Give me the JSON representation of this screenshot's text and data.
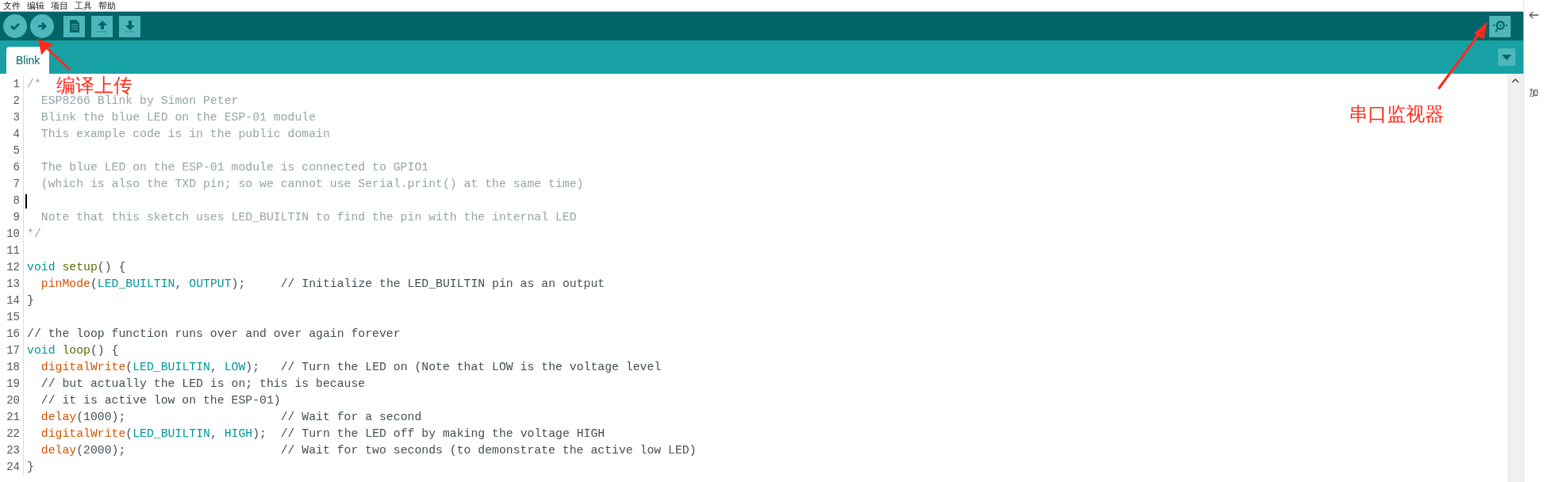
{
  "menu": [
    "文件",
    "编辑",
    "项目",
    "工具",
    "帮助"
  ],
  "toolbar": {
    "buttons": [
      {
        "kind": "verify"
      },
      {
        "kind": "upload"
      },
      {
        "kind": "new"
      },
      {
        "kind": "open"
      },
      {
        "kind": "save"
      }
    ],
    "right_button": {
      "kind": "serial-monitor"
    }
  },
  "tabs": [
    {
      "label": "Blink",
      "selected": true
    }
  ],
  "editor": {
    "lines": [
      {
        "n": "1",
        "cursor": false,
        "tokens": [
          {
            "kind": "comment",
            "t": "/*"
          }
        ]
      },
      {
        "n": "2",
        "cursor": false,
        "tokens": [
          {
            "kind": "comment",
            "t": "  ESP8266 Blink by Simon Peter"
          }
        ]
      },
      {
        "n": "3",
        "cursor": false,
        "tokens": [
          {
            "kind": "comment",
            "t": "  Blink the blue LED on the ESP-01 module"
          }
        ]
      },
      {
        "n": "4",
        "cursor": false,
        "tokens": [
          {
            "kind": "comment",
            "t": "  This example code is in the public domain"
          }
        ]
      },
      {
        "n": "5",
        "cursor": false
      },
      {
        "n": "6",
        "cursor": false,
        "tokens": [
          {
            "kind": "comment",
            "t": "  The blue LED on the ESP-01 module is connected to GPIO1"
          }
        ]
      },
      {
        "n": "7",
        "cursor": false,
        "tokens": [
          {
            "kind": "comment",
            "t": "  (which is also the TXD pin; so we cannot use Serial.print() at the same time)"
          }
        ]
      },
      {
        "n": "8",
        "cursor": true
      },
      {
        "n": "9",
        "cursor": false,
        "tokens": [
          {
            "kind": "comment",
            "t": "  Note that this sketch uses LED_BUILTIN to find the pin with the internal LED"
          }
        ]
      },
      {
        "n": "10",
        "cursor": false,
        "tokens": [
          {
            "kind": "comment",
            "t": "*/"
          }
        ]
      },
      {
        "n": "11",
        "cursor": false
      },
      {
        "n": "12",
        "cursor": false,
        "tokens": [
          {
            "kind": "keyword",
            "t": "void"
          },
          {
            "kind": "name",
            "t": " setup"
          },
          {
            "kind": "plain",
            "t": "() {"
          }
        ]
      },
      {
        "n": "13",
        "cursor": false,
        "tokens": [
          {
            "kind": "function",
            "t": "  pinMode"
          },
          {
            "kind": "plain",
            "t": "("
          },
          {
            "kind": "keyword",
            "t": "LED_BUILTIN"
          },
          {
            "kind": "plain",
            "t": ", "
          },
          {
            "kind": "keyword",
            "t": "OUTPUT"
          },
          {
            "kind": "plain",
            "t": ");     // Initialize the LED_BUILTIN pin as an output"
          }
        ]
      },
      {
        "n": "14",
        "cursor": false,
        "tokens": [
          {
            "kind": "plain",
            "t": "}"
          }
        ]
      },
      {
        "n": "15",
        "cursor": false
      },
      {
        "n": "16",
        "cursor": false,
        "tokens": [
          {
            "kind": "plain",
            "t": "// the loop function runs over and over again forever"
          }
        ]
      },
      {
        "n": "17",
        "cursor": false,
        "tokens": [
          {
            "kind": "keyword",
            "t": "void"
          },
          {
            "kind": "name",
            "t": " loop"
          },
          {
            "kind": "plain",
            "t": "() {"
          }
        ]
      },
      {
        "n": "18",
        "cursor": false,
        "tokens": [
          {
            "kind": "function",
            "t": "  digitalWrite"
          },
          {
            "kind": "plain",
            "t": "("
          },
          {
            "kind": "keyword",
            "t": "LED_BUILTIN"
          },
          {
            "kind": "plain",
            "t": ", "
          },
          {
            "kind": "keyword",
            "t": "LOW"
          },
          {
            "kind": "plain",
            "t": ");   // Turn the LED on (Note that LOW is the voltage level"
          }
        ]
      },
      {
        "n": "19",
        "cursor": false,
        "tokens": [
          {
            "kind": "plain",
            "t": "  // but actually the LED is on; this is because"
          }
        ]
      },
      {
        "n": "20",
        "cursor": false,
        "tokens": [
          {
            "kind": "plain",
            "t": "  // it is active low on the ESP-01)"
          }
        ]
      },
      {
        "n": "21",
        "cursor": false,
        "tokens": [
          {
            "kind": "function",
            "t": "  delay"
          },
          {
            "kind": "plain",
            "t": "(1000);                      // Wait for a second"
          }
        ]
      },
      {
        "n": "22",
        "cursor": false,
        "tokens": [
          {
            "kind": "function",
            "t": "  digitalWrite"
          },
          {
            "kind": "plain",
            "t": "("
          },
          {
            "kind": "keyword",
            "t": "LED_BUILTIN"
          },
          {
            "kind": "plain",
            "t": ", "
          },
          {
            "kind": "keyword",
            "t": "HIGH"
          },
          {
            "kind": "plain",
            "t": ");  // Turn the LED off by making the voltage HIGH"
          }
        ]
      },
      {
        "n": "23",
        "cursor": false,
        "tokens": [
          {
            "kind": "function",
            "t": "  delay"
          },
          {
            "kind": "plain",
            "t": "(2000);                      // Wait for two seconds (to demonstrate the active low LED)"
          }
        ]
      },
      {
        "n": "24",
        "cursor": false,
        "tokens": [
          {
            "kind": "plain",
            "t": "}"
          }
        ]
      }
    ]
  },
  "side_panel": {
    "label": "加"
  },
  "annotations": [
    {
      "text": "编译上传"
    },
    {
      "text": "串口监视器"
    }
  ]
}
